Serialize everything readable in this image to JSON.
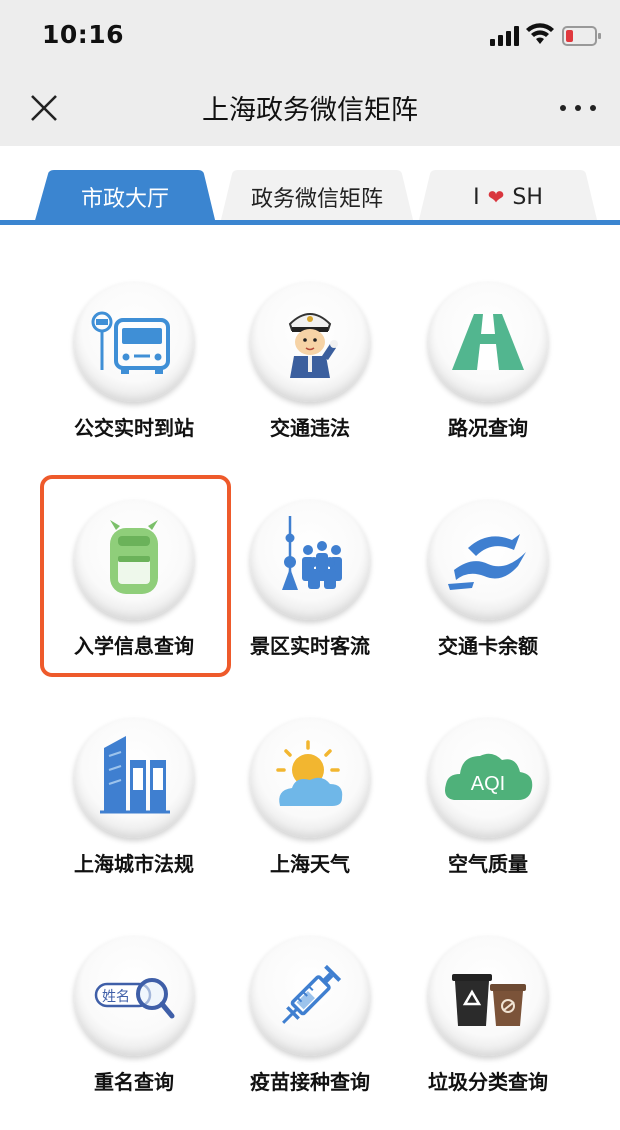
{
  "status_bar": {
    "time": "10:16"
  },
  "navbar": {
    "title": "上海政务微信矩阵"
  },
  "tabs": [
    {
      "label": "市政大厅",
      "active": true
    },
    {
      "label": "政务微信矩阵",
      "active": false
    },
    {
      "label_left": "I",
      "label_right": "SH",
      "active": false
    }
  ],
  "colors": {
    "accent": "#3b85d0",
    "highlight": "#ee5a2b",
    "nav_bg": "#ededed"
  },
  "services": [
    {
      "label": "公交实时到站",
      "icon": "bus-stop-icon"
    },
    {
      "label": "交通违法",
      "icon": "traffic-police-icon"
    },
    {
      "label": "路况查询",
      "icon": "road-icon"
    },
    {
      "label": "入学信息查询",
      "icon": "backpack-icon",
      "highlighted": true
    },
    {
      "label": "景区实时客流",
      "icon": "crowd-tower-icon"
    },
    {
      "label": "交通卡余额",
      "icon": "transport-card-icon"
    },
    {
      "label": "上海城市法规",
      "icon": "law-buildings-icon"
    },
    {
      "label": "上海天气",
      "icon": "weather-icon"
    },
    {
      "label": "空气质量",
      "icon": "aqi-cloud-icon",
      "icon_text": "AQI"
    },
    {
      "label": "重名查询",
      "icon": "name-search-icon",
      "icon_text": "姓名"
    },
    {
      "label": "疫苗接种查询",
      "icon": "syringe-icon"
    },
    {
      "label": "垃圾分类查询",
      "icon": "trash-bins-icon"
    }
  ]
}
